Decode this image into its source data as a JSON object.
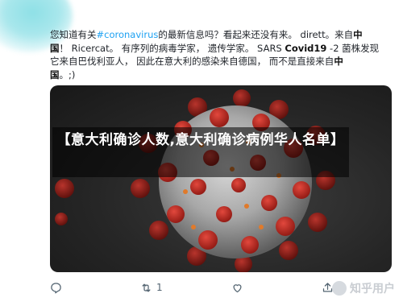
{
  "tweet": {
    "line1_prefix": "您知道有关",
    "hashtag": "#coronavirus",
    "line1_suffix": "的最新信息吗？看起来还没有来。 dirett。来自",
    "line1_bold": "中",
    "line2_bold": "国",
    "line2_rest": "！ Ricercat。 有序列的病毒学家， 遗传学家。 SARS ",
    "line2_bold2": "Covid19",
    "line2_tail": " -2 菌株发现",
    "line3": "它来自巴伐利亚人， 因此在意大利的感染来自德国， 而不是直接来自",
    "line3_bold": "中",
    "line4_bold": "国",
    "line4_rest": "。;)"
  },
  "overlay": {
    "title": "【意大利确诊人数,意大利确诊病例华人名单】"
  },
  "actions": {
    "reply_icon": "reply-icon",
    "retweet_icon": "retweet-icon",
    "retweet_count": "1",
    "like_icon": "heart-icon",
    "share_icon": "share-icon"
  },
  "watermark": {
    "text": "知乎用户"
  },
  "colors": {
    "hashtag": "#1da1f2",
    "text": "#1f2329",
    "icon": "#536471",
    "virus_red": "#c0261f"
  }
}
